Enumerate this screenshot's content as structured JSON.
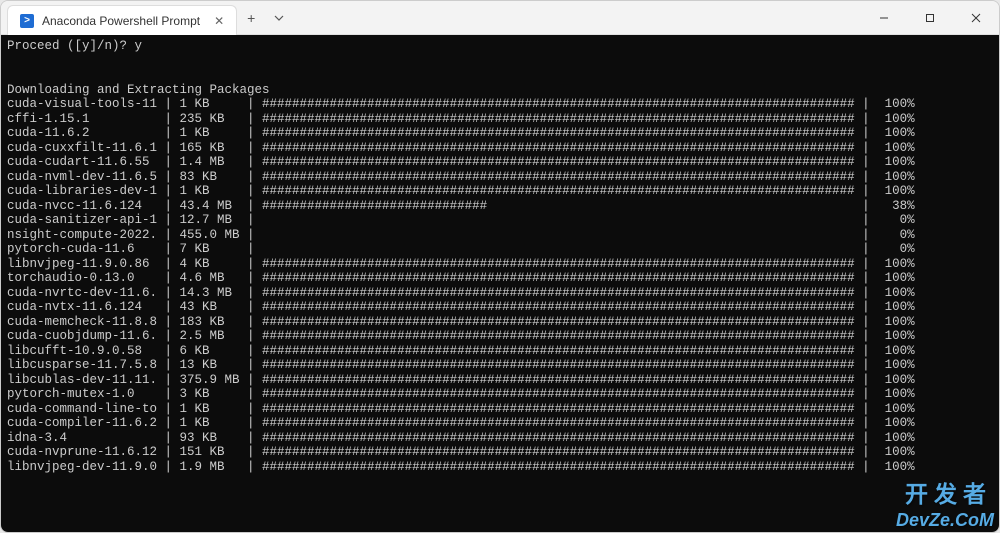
{
  "window": {
    "tab_title": "Anaconda Powershell Prompt",
    "tab_icon_letter": ">"
  },
  "terminal": {
    "prompt_line": "Proceed ([y]/n)? y",
    "section_header": "Downloading and Extracting Packages",
    "packages": [
      {
        "name": "cuda-visual-tools-11",
        "size": "1 KB",
        "percent": 100
      },
      {
        "name": "cffi-1.15.1",
        "size": "235 KB",
        "percent": 100
      },
      {
        "name": "cuda-11.6.2",
        "size": "1 KB",
        "percent": 100
      },
      {
        "name": "cuda-cuxxfilt-11.6.1",
        "size": "165 KB",
        "percent": 100
      },
      {
        "name": "cuda-cudart-11.6.55",
        "size": "1.4 MB",
        "percent": 100
      },
      {
        "name": "cuda-nvml-dev-11.6.5",
        "size": "83 KB",
        "percent": 100
      },
      {
        "name": "cuda-libraries-dev-1",
        "size": "1 KB",
        "percent": 100
      },
      {
        "name": "cuda-nvcc-11.6.124",
        "size": "43.4 MB",
        "percent": 38
      },
      {
        "name": "cuda-sanitizer-api-1",
        "size": "12.7 MB",
        "percent": 0
      },
      {
        "name": "nsight-compute-2022.",
        "size": "455.0 MB",
        "percent": 0
      },
      {
        "name": "pytorch-cuda-11.6",
        "size": "7 KB",
        "percent": 0
      },
      {
        "name": "libnvjpeg-11.9.0.86",
        "size": "4 KB",
        "percent": 100
      },
      {
        "name": "torchaudio-0.13.0",
        "size": "4.6 MB",
        "percent": 100
      },
      {
        "name": "cuda-nvrtc-dev-11.6.",
        "size": "14.3 MB",
        "percent": 100
      },
      {
        "name": "cuda-nvtx-11.6.124",
        "size": "43 KB",
        "percent": 100
      },
      {
        "name": "cuda-memcheck-11.8.8",
        "size": "183 KB",
        "percent": 100
      },
      {
        "name": "cuda-cuobjdump-11.6.",
        "size": "2.5 MB",
        "percent": 100
      },
      {
        "name": "libcufft-10.9.0.58",
        "size": "6 KB",
        "percent": 100
      },
      {
        "name": "libcusparse-11.7.5.8",
        "size": "13 KB",
        "percent": 100
      },
      {
        "name": "libcublas-dev-11.11.",
        "size": "375.9 MB",
        "percent": 100
      },
      {
        "name": "pytorch-mutex-1.0",
        "size": "3 KB",
        "percent": 100
      },
      {
        "name": "cuda-command-line-to",
        "size": "1 KB",
        "percent": 100
      },
      {
        "name": "cuda-compiler-11.6.2",
        "size": "1 KB",
        "percent": 100
      },
      {
        "name": "idna-3.4",
        "size": "93 KB",
        "percent": 100
      },
      {
        "name": "cuda-nvprune-11.6.12",
        "size": "151 KB",
        "percent": 100
      },
      {
        "name": "libnvjpeg-dev-11.9.0",
        "size": "1.9 MB",
        "percent": 100
      }
    ],
    "bar_full_width": 79
  },
  "watermark": {
    "line1": "开发者",
    "line2": "DevZe.CoM"
  }
}
